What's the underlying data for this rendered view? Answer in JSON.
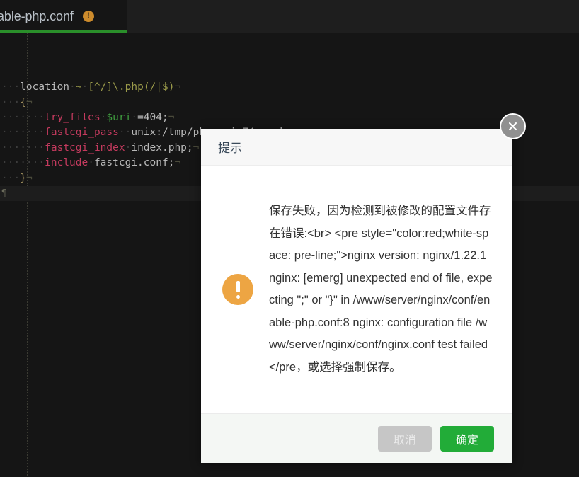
{
  "editor": {
    "tab": {
      "label": "able-php.conf",
      "dirty_icon": "warning-dot-icon",
      "active": true,
      "active_underline_color": "#2a8f2a"
    },
    "code_lines": [
      {
        "id": 1,
        "tokens": [
          {
            "t": "···",
            "c": "ws"
          },
          {
            "t": "location",
            "c": "val"
          },
          {
            "t": "·",
            "c": "ws"
          },
          {
            "t": "~",
            "c": "reg"
          },
          {
            "t": "·",
            "c": "ws"
          },
          {
            "t": "[^/]\\.php(/|$)",
            "c": "reg"
          },
          {
            "t": "¬",
            "c": "eol"
          }
        ]
      },
      {
        "id": 2,
        "tokens": [
          {
            "t": "···",
            "c": "ws"
          },
          {
            "t": "{",
            "c": "punc"
          },
          {
            "t": "¬",
            "c": "eol"
          }
        ]
      },
      {
        "id": 3,
        "tokens": [
          {
            "t": "·······",
            "c": "ws"
          },
          {
            "t": "try_files",
            "c": "dir"
          },
          {
            "t": "·",
            "c": "ws"
          },
          {
            "t": "$uri",
            "c": "var"
          },
          {
            "t": "·",
            "c": "ws"
          },
          {
            "t": "=404;",
            "c": "val"
          },
          {
            "t": "¬",
            "c": "eol"
          }
        ]
      },
      {
        "id": 4,
        "tokens": [
          {
            "t": "·······",
            "c": "ws"
          },
          {
            "t": "fastcgi_pass",
            "c": "dir"
          },
          {
            "t": "··",
            "c": "ws"
          },
          {
            "t": "unix:/tmp/php-cgi-74.sock;",
            "c": "val"
          },
          {
            "t": "¬",
            "c": "eol"
          }
        ]
      },
      {
        "id": 5,
        "tokens": [
          {
            "t": "·······",
            "c": "ws"
          },
          {
            "t": "fastcgi_index",
            "c": "dir"
          },
          {
            "t": "·",
            "c": "ws"
          },
          {
            "t": "index.php;",
            "c": "val"
          },
          {
            "t": "¬",
            "c": "eol"
          }
        ]
      },
      {
        "id": 6,
        "tokens": [
          {
            "t": "·······",
            "c": "ws"
          },
          {
            "t": "include",
            "c": "dir"
          },
          {
            "t": "·",
            "c": "ws"
          },
          {
            "t": "fastcgi.conf;",
            "c": "val"
          },
          {
            "t": "¬",
            "c": "eol"
          }
        ]
      },
      {
        "id": 7,
        "tokens": [
          {
            "t": "···",
            "c": "ws"
          },
          {
            "t": "}",
            "c": "punc"
          },
          {
            "t": "¬",
            "c": "eol"
          }
        ]
      },
      {
        "id": 8,
        "current": true,
        "tokens": [
          {
            "t": "¶",
            "c": "eof"
          }
        ]
      }
    ]
  },
  "dialog": {
    "title": "提示",
    "close_icon": "close-icon",
    "status_icon": "warning-exclamation-icon",
    "status_icon_color": "#eda543",
    "message": "保存失败，因为检测到被修改的配置文件存在错误:<br> <pre style=\"color:red;white-space: pre-line;\">nginx version: nginx/1.22.1 nginx: [emerg] unexpected end of file, expecting \";\" or \"}\" in /www/server/nginx/conf/enable-php.conf:8 nginx: configuration file /www/server/nginx/conf/nginx.conf test failed </pre，或选择强制保存。",
    "buttons": {
      "cancel": "取消",
      "confirm": "确定",
      "confirm_color": "#22ac38",
      "cancel_color": "#c6c6c6"
    }
  }
}
